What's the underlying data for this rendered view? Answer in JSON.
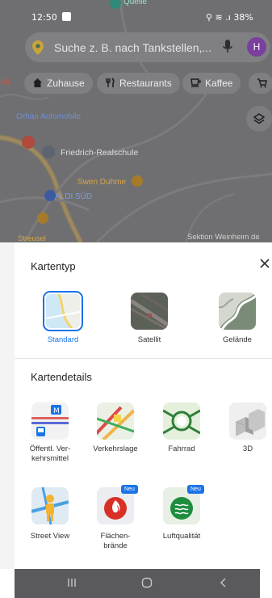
{
  "status": {
    "time": "12:50",
    "battery": "38%"
  },
  "search": {
    "placeholder": "Suche z. B. nach Tankstellen,...",
    "avatar_letter": "H"
  },
  "chips": [
    {
      "label": "Zuhause",
      "icon": "home-icon"
    },
    {
      "label": "Restaurants",
      "icon": "fork-knife-icon"
    },
    {
      "label": "Kaffee",
      "icon": "coffee-icon"
    }
  ],
  "map": {
    "labels": {
      "quelle": "Quelle",
      "orhan": "Orhan Automobile",
      "school": "Friedrich-Realschule",
      "duhme": "Swen Duhme",
      "aldi": "ALDI SÜD",
      "streusel": "Streusel",
      "weinheim": "Sektion Weinheim de",
      "mi": "Mi"
    }
  },
  "sheet": {
    "title": "Kartentyp",
    "map_types": [
      {
        "label": "Standard",
        "selected": true
      },
      {
        "label": "Satellit",
        "selected": false
      },
      {
        "label": "Gelände",
        "selected": false
      }
    ],
    "details_title": "Kartendetails",
    "details": [
      {
        "label": "Öffentl. Ver-\nkehrsmittel"
      },
      {
        "label": "Verkehrslage"
      },
      {
        "label": "Fahrrad"
      },
      {
        "label": "3D"
      },
      {
        "label": "Street View"
      },
      {
        "label": "Flächen-\nbrände",
        "badge": "Neu"
      },
      {
        "label": "Luftqualität",
        "badge": "Neu"
      }
    ]
  },
  "colors": {
    "accent": "#1a73e8",
    "map_dim": "#6e6e70"
  }
}
